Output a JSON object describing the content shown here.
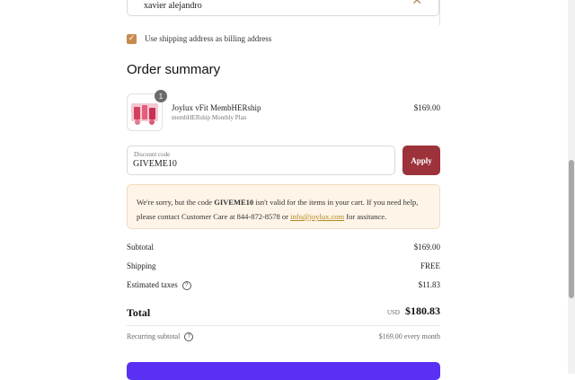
{
  "shipping": {
    "name_value": "xavier alejandro",
    "clear_icon": "close-icon"
  },
  "billing_checkbox": {
    "checked": true,
    "label": "Use shipping address as billing address"
  },
  "order_summary": {
    "title": "Order summary",
    "product": {
      "quantity": "1",
      "name": "Joylux vFit MembHERship",
      "plan": "membHERship Monthly Plan",
      "price": "$169.00"
    },
    "discount": {
      "label": "Discount code",
      "value": "GIVEME10",
      "apply_label": "Apply"
    },
    "error": {
      "text_before": "We're sorry, but the code ",
      "code": "GIVEME10",
      "text_middle": " isn't valid for the items in your cart. If you need help, please contact Customer Care at 844-872-8578 or ",
      "email": "info@joylux.com",
      "text_after": " for assitance."
    },
    "subtotal": {
      "label": "Subtotal",
      "value": "$169.00"
    },
    "shipping": {
      "label": "Shipping",
      "value": "FREE"
    },
    "taxes": {
      "label": "Estimated taxes",
      "value": "$11.83"
    },
    "total": {
      "label": "Total",
      "currency": "USD",
      "value": "$180.83"
    },
    "recurring": {
      "label": "Recurring subtotal",
      "value": "$169.00 every month"
    }
  },
  "colors": {
    "accent_checkbox": "#c68b4e",
    "apply_button": "#9c323a",
    "pay_button": "#5a31f4",
    "error_bg": "#fef4e7"
  }
}
